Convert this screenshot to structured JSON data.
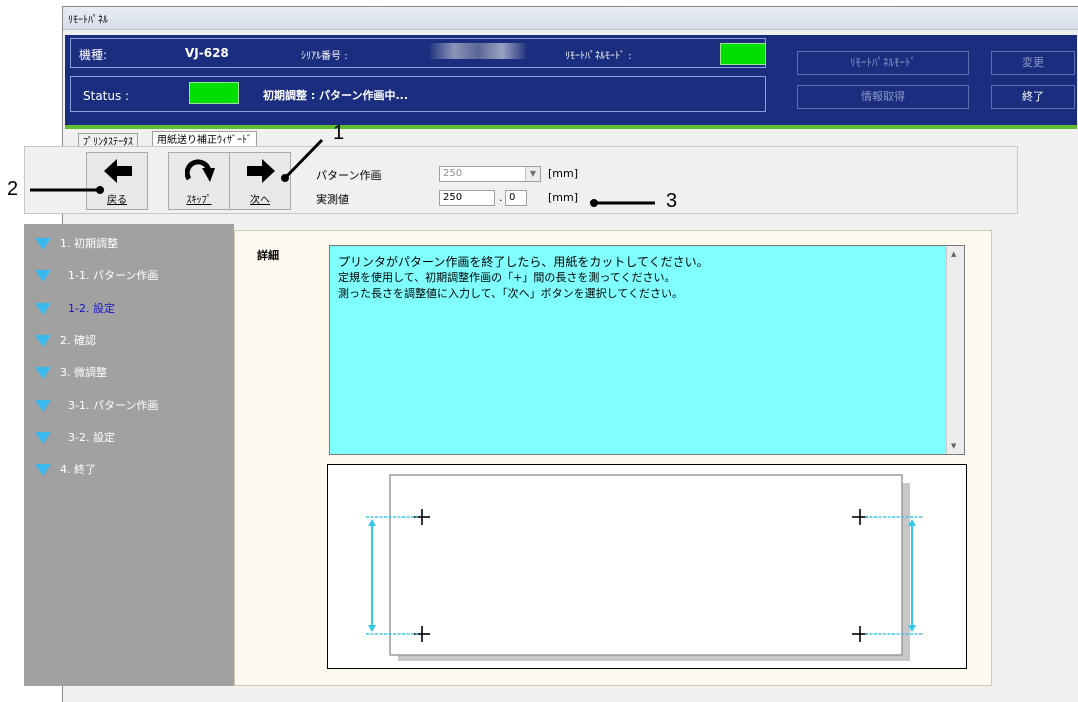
{
  "window": {
    "title": "ﾘﾓｰﾄﾊﾟﾈﾙ"
  },
  "header": {
    "model_label": "機種:",
    "model_value": "VJ-628",
    "serial_label": "ｼﾘｱﾙ番号 :",
    "remote_mode_label": "ﾘﾓｰﾄﾊﾟﾈﾙﾓｰﾄﾞ :",
    "status_label": "Status :",
    "status_text": "初期調整 : パターン作画中...",
    "buttons": {
      "remote_mode": "ﾘﾓｰﾄﾊﾟﾈﾙﾓｰﾄﾞ",
      "change": "変更",
      "info": "情報取得",
      "exit": "終了"
    },
    "indicator_color": "#00e000"
  },
  "tabs": [
    {
      "label": "ﾌﾟﾘﾝﾀｽﾃｰﾀｽ"
    },
    {
      "label": "用紙送り補正ｳｨｻﾞｰﾄﾞ"
    }
  ],
  "toolbar": {
    "back_label": "戻る",
    "skip_label": "ｽｷｯﾌﾟ",
    "next_label": "次へ",
    "pattern_label": "パターン作画",
    "pattern_value": "250",
    "pattern_unit": "[mm]",
    "measured_label": "実測値",
    "measured_int": "250",
    "measured_dec": "0",
    "measured_unit": "[mm]"
  },
  "sidebar": {
    "items": [
      {
        "label": "1. 初期調整"
      },
      {
        "label": "1-1. パターン作画"
      },
      {
        "label": "1-2. 設定"
      },
      {
        "label": "2. 確認"
      },
      {
        "label": "3. 微調整"
      },
      {
        "label": "3-1. パターン作画"
      },
      {
        "label": "3-2. 設定"
      },
      {
        "label": "4. 終了"
      }
    ]
  },
  "detail": {
    "label": "詳細",
    "lines": [
      "プリンタがパターン作画を終了したら、用紙をカットしてください。",
      "定規を使用して、初期調整作画の「+」間の長さを測ってください。",
      "測った長さを調整値に入力して、「次へ」ボタンを選択してください。"
    ]
  },
  "callouts": {
    "c1": "1",
    "c2": "2",
    "c3": "3"
  },
  "colors": {
    "header_bg": "#1b2d7e",
    "detail_bg": "#80ffff",
    "measure_line": "#35c8e8",
    "sidebar_bg": "#a1a1a1",
    "tri": "#39b8ee"
  }
}
